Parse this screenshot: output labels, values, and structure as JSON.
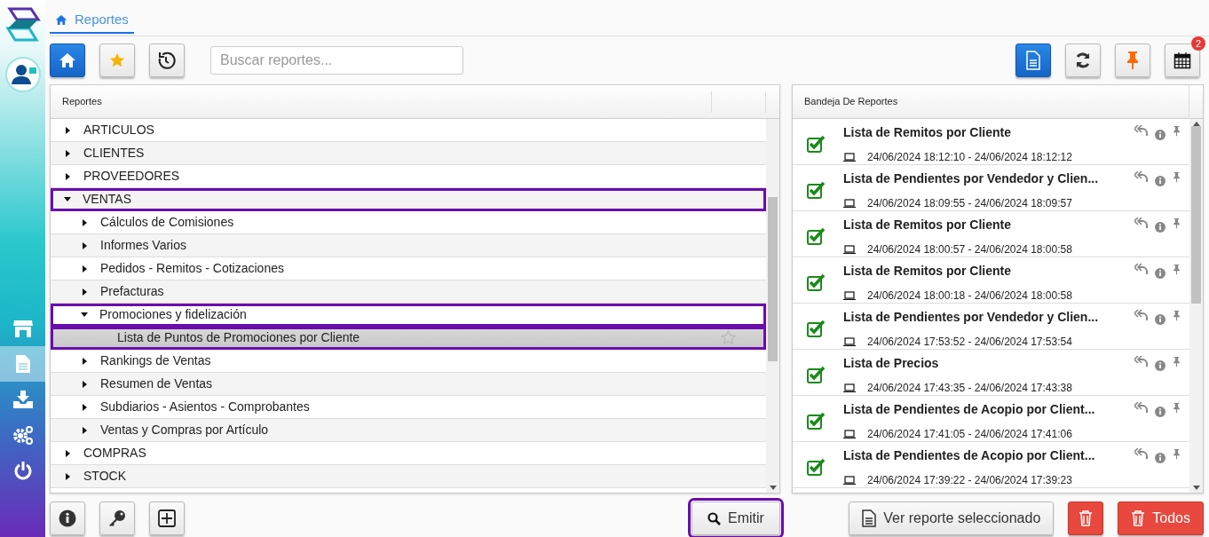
{
  "tab": {
    "label": "Reportes",
    "selected": true
  },
  "search": {
    "placeholder": "Buscar reportes..."
  },
  "calendar_badge": "2",
  "sidebar": {
    "items": [
      {
        "selected": false
      },
      {
        "selected": true
      },
      {
        "selected": false
      },
      {
        "selected": false
      },
      {
        "selected": false
      }
    ]
  },
  "reports_panel": {
    "title": "Reportes",
    "tree": [
      {
        "label": "ARTICULOS",
        "expanded": false,
        "selected": false,
        "highlighted": false
      },
      {
        "label": "CLIENTES",
        "expanded": false,
        "selected": false,
        "highlighted": false
      },
      {
        "label": "PROVEEDORES",
        "expanded": false,
        "selected": false,
        "highlighted": false
      },
      {
        "label": "VENTAS",
        "expanded": true,
        "selected": false,
        "highlighted": true,
        "children": [
          {
            "label": "Cálculos de Comisiones",
            "expanded": false,
            "selected": false,
            "highlighted": false
          },
          {
            "label": "Informes Varios",
            "expanded": false,
            "selected": false,
            "highlighted": false
          },
          {
            "label": "Pedidos - Remitos - Cotizaciones",
            "expanded": false,
            "selected": false,
            "highlighted": false
          },
          {
            "label": "Prefacturas",
            "expanded": false,
            "selected": false,
            "highlighted": false
          },
          {
            "label": "Promociones y fidelización",
            "expanded": true,
            "selected": false,
            "highlighted": true,
            "children": [
              {
                "label": "Lista de Puntos de Promociones por Cliente",
                "selected": true,
                "highlighted": true
              }
            ]
          },
          {
            "label": "Rankings de Ventas",
            "expanded": false,
            "selected": false,
            "highlighted": false
          },
          {
            "label": "Resumen de Ventas",
            "expanded": false,
            "selected": false,
            "highlighted": false
          },
          {
            "label": "Subdiarios - Asientos - Comprobantes",
            "expanded": false,
            "selected": false,
            "highlighted": false
          },
          {
            "label": "Ventas y Compras por Artículo",
            "expanded": false,
            "selected": false,
            "highlighted": false
          }
        ]
      },
      {
        "label": "COMPRAS",
        "expanded": false,
        "selected": false,
        "highlighted": false
      },
      {
        "label": "STOCK",
        "expanded": false,
        "selected": false,
        "highlighted": false
      }
    ]
  },
  "emit_button": {
    "label": "Emitir",
    "highlighted": true
  },
  "tray_panel": {
    "title": "Bandeja De Reportes",
    "items": [
      {
        "title": "Lista de Remitos por Cliente",
        "time": "24/06/2024 18:12:10 - 24/06/2024 18:12:12"
      },
      {
        "title": "Lista de Pendientes por Vendedor y Clien...",
        "time": "24/06/2024 18:09:55 - 24/06/2024 18:09:57"
      },
      {
        "title": "Lista de Remitos por Cliente",
        "time": "24/06/2024 18:00:57 - 24/06/2024 18:00:58"
      },
      {
        "title": "Lista de Remitos por Cliente",
        "time": "24/06/2024 18:00:18 - 24/06/2024 18:00:58"
      },
      {
        "title": "Lista de Pendientes por Vendedor y Clien...",
        "time": "24/06/2024 17:53:52 - 24/06/2024 17:53:54"
      },
      {
        "title": "Lista de Precios",
        "time": "24/06/2024 17:43:35 - 24/06/2024 17:43:38"
      },
      {
        "title": "Lista de Pendientes de Acopio por Client...",
        "time": "24/06/2024 17:41:05 - 24/06/2024 17:41:06"
      },
      {
        "title": "Lista de Pendientes de Acopio por Client...",
        "time": "24/06/2024 17:39:22 - 24/06/2024 17:39:23"
      }
    ]
  },
  "view_button": {
    "label": "Ver reporte seleccionado"
  },
  "delete_all_button": {
    "label": "Todos"
  }
}
